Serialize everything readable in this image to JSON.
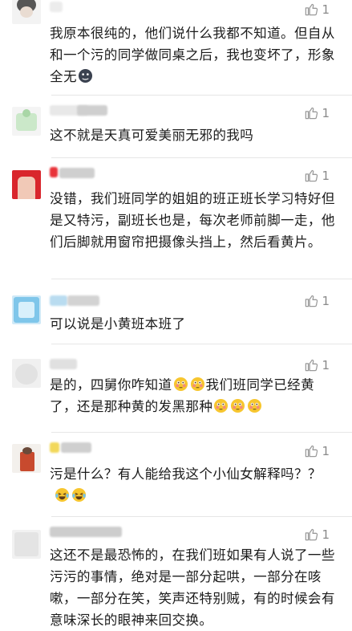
{
  "comments": [
    {
      "likes": "1",
      "text": "我原本很纯的，他们说什么我都不知道。但自从和一个污的同学做同桌之后，我也变坏了，形象全无",
      "emoji": "dark-face-emoji"
    },
    {
      "likes": "1",
      "text": "这不就是天真可爱美丽无邪的我吗"
    },
    {
      "likes": "1",
      "text": "没错，我们班同学的姐姐的班正班长学习特好但是又特污，副班长也是，每次老师前脚一走，他们后脚就用窗帘把摄像头挡上，然后看黄片。"
    },
    {
      "likes": "1",
      "text": "可以说是小黄班本班了"
    },
    {
      "likes": "1",
      "text_a": "是的，四舅你咋知道",
      "text_b": "我们班同学已经黄了，还是那种黄的发黑那种",
      "emoji": "flushed-face-emoji"
    },
    {
      "likes": "1",
      "text": "污是什么？有人能给我这个小仙女解释吗？？",
      "emoji": "laughing-tears-emoji"
    },
    {
      "likes": "1",
      "text": "这还不是最恐怖的，在我们班如果有人说了一些污污的事情，绝对是一部分起哄，一部分在咳嗽，一部分在笑，笑声还特别贼，有的时候会有意味深长的眼神来回交换。"
    }
  ],
  "colors": {
    "like_icon": "#9a9a9a",
    "divider": "#e6e6e6",
    "emoji_yellow": "#f7c62f"
  }
}
